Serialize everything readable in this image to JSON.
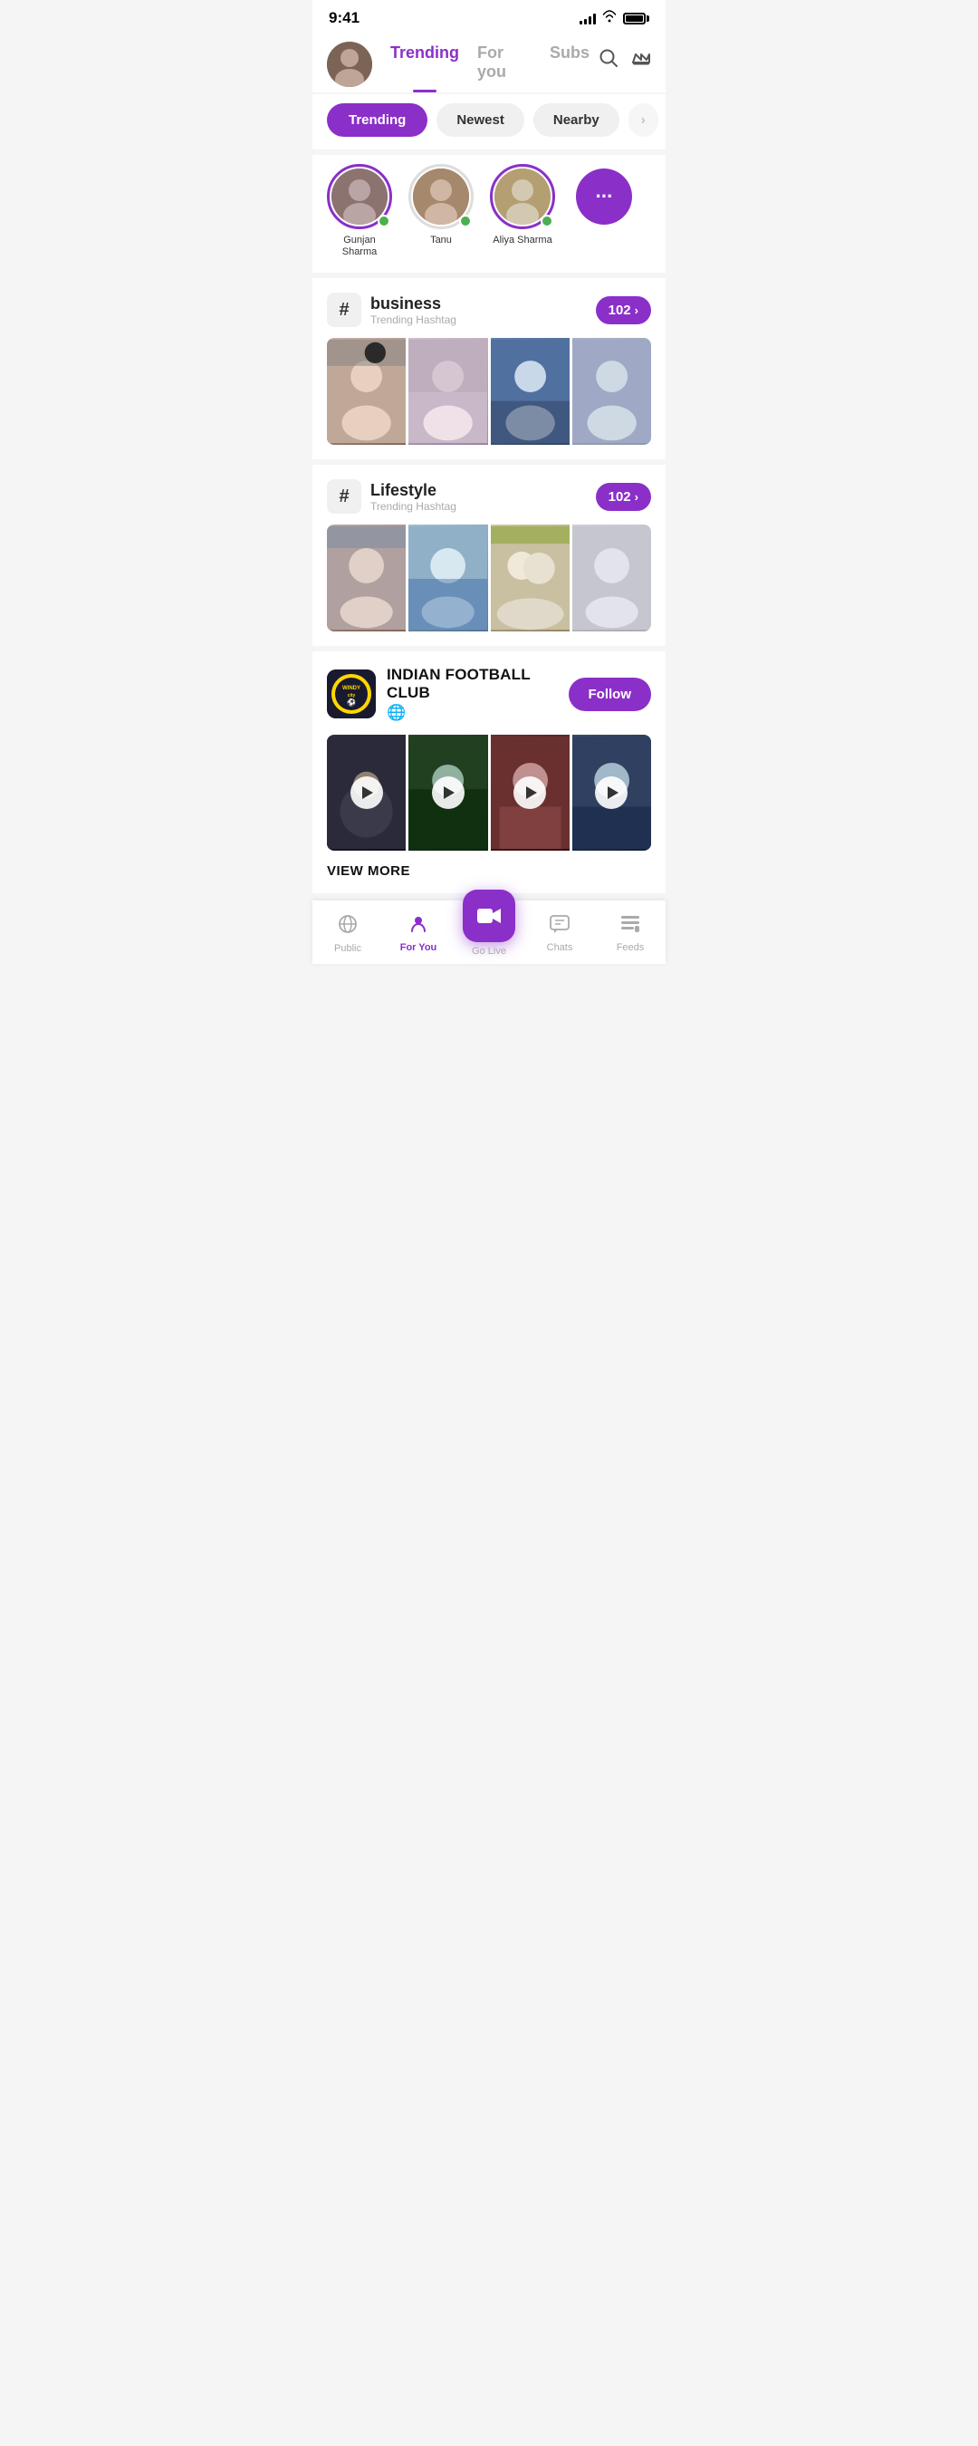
{
  "statusBar": {
    "time": "9:41",
    "signal": "signal",
    "wifi": "wifi",
    "battery": "battery"
  },
  "header": {
    "tabs": [
      {
        "id": "trending",
        "label": "Trending",
        "active": true
      },
      {
        "id": "foryou",
        "label": "For you",
        "active": false
      },
      {
        "id": "subs",
        "label": "Subs",
        "active": false
      }
    ],
    "searchIcon": "search",
    "crownIcon": "crown"
  },
  "filterBar": {
    "pills": [
      {
        "id": "trending",
        "label": "Trending",
        "active": true
      },
      {
        "id": "newest",
        "label": "Newest",
        "active": false
      },
      {
        "id": "nearby",
        "label": "Nearby",
        "active": false
      }
    ]
  },
  "stories": {
    "items": [
      {
        "id": "1",
        "name": "Gunjan Sharma",
        "online": true,
        "hasRing": true
      },
      {
        "id": "2",
        "name": "Tanu",
        "online": true,
        "hasRing": false
      },
      {
        "id": "3",
        "name": "Aliya Sharma",
        "online": true,
        "hasRing": true
      },
      {
        "id": "4",
        "name": "more",
        "isMore": true
      }
    ]
  },
  "hashtags": [
    {
      "id": "business",
      "title": "business",
      "subtitle": "Trending Hashtag",
      "count": "102",
      "photos": [
        "photo1",
        "photo2",
        "photo3",
        "photo4"
      ]
    },
    {
      "id": "lifestyle",
      "title": "Lifestyle",
      "subtitle": "Trending Hashtag",
      "count": "102",
      "photos": [
        "photo5",
        "photo6",
        "photo7",
        "photo8"
      ]
    }
  ],
  "club": {
    "logoText": "WINDY city",
    "name": "INDIAN FOOTBALL CLUB",
    "globeIcon": "🌐",
    "followLabel": "Follow",
    "viewMoreLabel": "VIEW MORE",
    "videos": [
      "video1",
      "video2",
      "video3",
      "video4"
    ]
  },
  "bottomNav": {
    "tabs": [
      {
        "id": "public",
        "label": "Public",
        "icon": "radio",
        "active": false
      },
      {
        "id": "foryou",
        "label": "For You",
        "icon": "person",
        "active": true
      },
      {
        "id": "golive",
        "label": "Go Live",
        "icon": "camera",
        "isCenter": true
      },
      {
        "id": "chats",
        "label": "Chats",
        "icon": "chat",
        "active": false
      },
      {
        "id": "feeds",
        "label": "Feeds",
        "icon": "feeds",
        "active": false
      }
    ]
  }
}
